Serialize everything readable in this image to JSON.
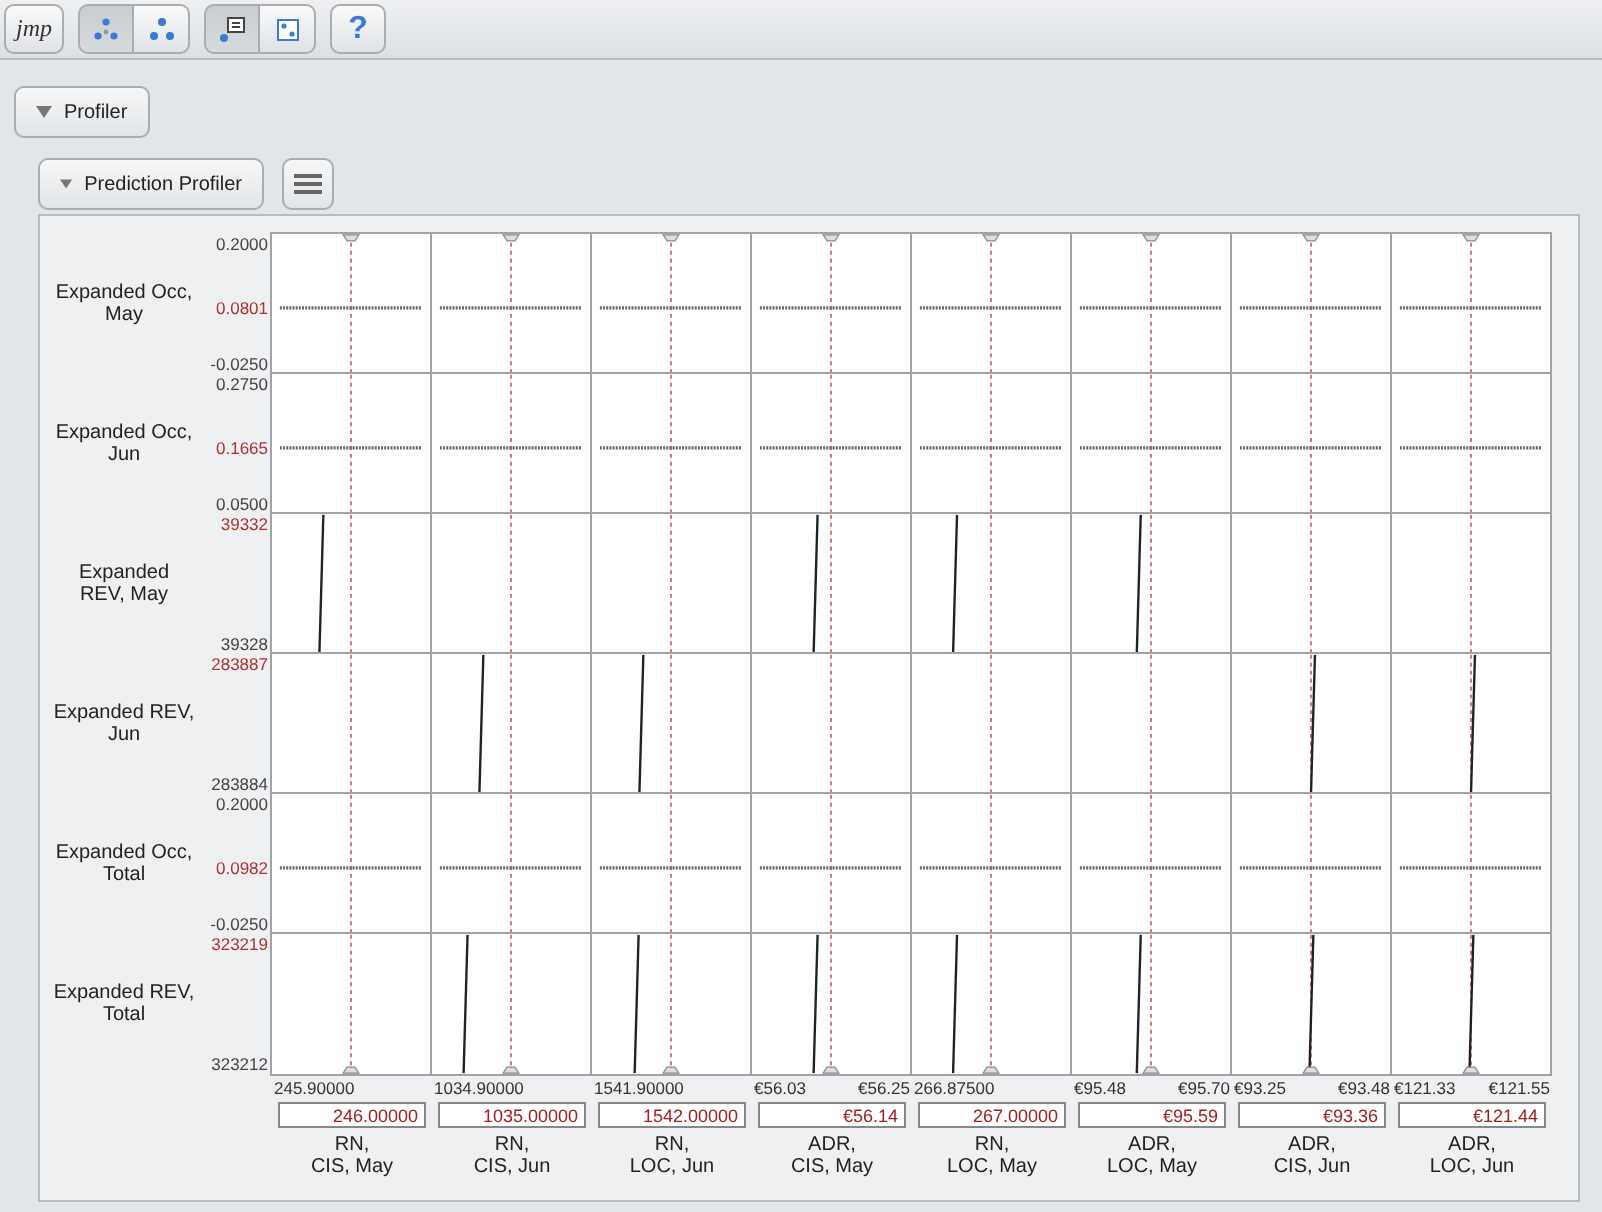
{
  "toolbar": {
    "logo": "jmp",
    "groups": [
      [
        {
          "kind": "dots-grid",
          "selected": true
        },
        {
          "kind": "dots-triangle",
          "selected": false
        }
      ],
      [
        {
          "kind": "legend",
          "selected": true
        },
        {
          "kind": "dice",
          "selected": false
        }
      ]
    ],
    "help": "?"
  },
  "outline": {
    "title": "Profiler",
    "expanded": true
  },
  "profiler": {
    "title": "Prediction Profiler",
    "expanded": true
  },
  "responses": [
    {
      "label": "Expanded Occ,\nMay",
      "ticks": [
        {
          "kind": "top",
          "label": "0.2000",
          "current": false
        },
        {
          "kind": "middle",
          "label": "0.0801",
          "current": true
        },
        {
          "kind": "bottom",
          "label": "-0.0250",
          "current": false
        }
      ],
      "cells": [
        {
          "kind": "flat"
        },
        {
          "kind": "flat"
        },
        {
          "kind": "flat"
        },
        {
          "kind": "flat"
        },
        {
          "kind": "flat"
        },
        {
          "kind": "flat"
        },
        {
          "kind": "flat"
        },
        {
          "kind": "flat"
        }
      ]
    },
    {
      "label": "Expanded Occ,\nJun",
      "ticks": [
        {
          "kind": "top",
          "label": "0.2750",
          "current": false
        },
        {
          "kind": "middle",
          "label": "0.1665",
          "current": true
        },
        {
          "kind": "bottom",
          "label": "0.0500",
          "current": false
        }
      ],
      "cells": [
        {
          "kind": "flat"
        },
        {
          "kind": "flat"
        },
        {
          "kind": "flat"
        },
        {
          "kind": "flat"
        },
        {
          "kind": "flat"
        },
        {
          "kind": "flat"
        },
        {
          "kind": "flat"
        },
        {
          "kind": "flat"
        }
      ]
    },
    {
      "label": "Expanded\nREV, May",
      "ticks": [
        {
          "kind": "top",
          "label": "39332",
          "current": true
        },
        {
          "kind": "bottom",
          "label": "39328",
          "current": false
        }
      ],
      "cells": [
        {
          "kind": "steep"
        },
        {
          "kind": "none"
        },
        {
          "kind": "none"
        },
        {
          "kind": "steep"
        },
        {
          "kind": "steep"
        },
        {
          "kind": "steep"
        },
        {
          "kind": "none"
        },
        {
          "kind": "none"
        }
      ]
    },
    {
      "label": "Expanded REV,\nJun",
      "ticks": [
        {
          "kind": "top",
          "label": "283887",
          "current": true
        },
        {
          "kind": "bottom",
          "label": "283884",
          "current": false
        }
      ],
      "cells": [
        {
          "kind": "none"
        },
        {
          "kind": "steep"
        },
        {
          "kind": "steep"
        },
        {
          "kind": "none"
        },
        {
          "kind": "none"
        },
        {
          "kind": "none"
        },
        {
          "kind": "steep"
        },
        {
          "kind": "steep"
        }
      ]
    },
    {
      "label": "Expanded Occ,\nTotal",
      "ticks": [
        {
          "kind": "top",
          "label": "0.2000",
          "current": false
        },
        {
          "kind": "middle",
          "label": "0.0982",
          "current": true
        },
        {
          "kind": "bottom",
          "label": "-0.0250",
          "current": false
        }
      ],
      "cells": [
        {
          "kind": "flat"
        },
        {
          "kind": "flat"
        },
        {
          "kind": "flat"
        },
        {
          "kind": "flat"
        },
        {
          "kind": "flat"
        },
        {
          "kind": "flat"
        },
        {
          "kind": "flat"
        },
        {
          "kind": "flat"
        }
      ]
    },
    {
      "label": "Expanded REV,\nTotal",
      "ticks": [
        {
          "kind": "top",
          "label": "323219",
          "current": true
        },
        {
          "kind": "bottom",
          "label": "323212",
          "current": false
        }
      ],
      "cells": [
        {
          "kind": "none"
        },
        {
          "kind": "steep"
        },
        {
          "kind": "steep"
        },
        {
          "kind": "steep"
        },
        {
          "kind": "steep"
        },
        {
          "kind": "steep"
        },
        {
          "kind": "steep"
        },
        {
          "kind": "steep"
        }
      ]
    }
  ],
  "factors": [
    {
      "label": "RN,\nCIS, May",
      "min": "245.90000",
      "value": "246.00000"
    },
    {
      "label": "RN,\nCIS, Jun",
      "min": "1034.90000",
      "value": "1035.00000"
    },
    {
      "label": "RN,\nLOC, Jun",
      "min": "1541.90000",
      "value": "1542.00000"
    },
    {
      "label": "ADR,\nCIS, May",
      "min": "€56.03",
      "max": "€56.25",
      "value": "€56.14"
    },
    {
      "label": "RN,\nLOC, May",
      "min": "266.87500",
      "value": "267.00000"
    },
    {
      "label": "ADR,\nLOC, May",
      "min": "€95.48",
      "max": "€95.70",
      "value": "€95.59"
    },
    {
      "label": "ADR,\nCIS, Jun",
      "min": "€93.25",
      "max": "€93.48",
      "value": "€93.36"
    },
    {
      "label": "ADR,\nLOC, Jun",
      "min": "€121.33",
      "max": "€121.55",
      "value": "€121.44"
    }
  ]
}
